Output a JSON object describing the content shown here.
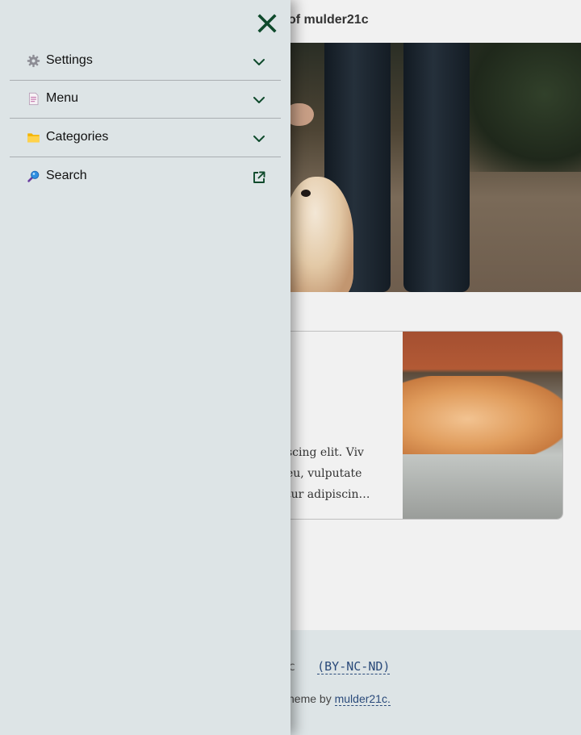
{
  "page": {
    "title": "of mulder21c",
    "card_excerpt": [
      "scing elit. Viv",
      "eu, vulputate",
      "tur adipiscin…"
    ],
    "footer": {
      "license_prefix": "c",
      "license_link": "(BY-NC-ND)",
      "credit_prefix": "heme by",
      "credit_link": "mulder21c."
    }
  },
  "drawer": {
    "close_icon": "close-icon",
    "items": [
      {
        "label": "Settings",
        "icon": "gear-icon",
        "trail": "chevron-down-icon"
      },
      {
        "label": "Menu",
        "icon": "document-icon",
        "trail": "chevron-down-icon"
      },
      {
        "label": "Categories",
        "icon": "folder-icon",
        "trail": "chevron-down-icon"
      },
      {
        "label": "Search",
        "icon": "magnifier-icon",
        "trail": "external-link-icon"
      }
    ]
  },
  "colors": {
    "drawer_bg": "#dde4e6",
    "accent": "#0f4a2c",
    "link": "#2a4a7a"
  }
}
